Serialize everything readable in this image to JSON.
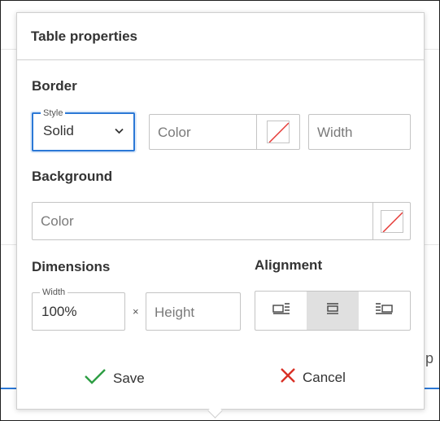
{
  "dialog": {
    "title": "Table properties"
  },
  "border": {
    "title": "Border",
    "style_label": "Style",
    "style_value": "Solid",
    "color_placeholder": "Color",
    "width_placeholder": "Width"
  },
  "background": {
    "title": "Background",
    "color_placeholder": "Color"
  },
  "dimensions": {
    "title": "Dimensions",
    "width_label": "Width",
    "width_value": "100%",
    "separator": "×",
    "height_placeholder": "Height"
  },
  "alignment": {
    "title": "Alignment",
    "options": [
      "align-left",
      "align-center",
      "align-right"
    ],
    "selected": "align-center"
  },
  "actions": {
    "save_label": "Save",
    "cancel_label": "Cancel"
  },
  "colors": {
    "focus": "#2b78d6",
    "save_icon": "#2e9e44",
    "cancel_icon": "#d93025",
    "no_color": "#e53935"
  }
}
